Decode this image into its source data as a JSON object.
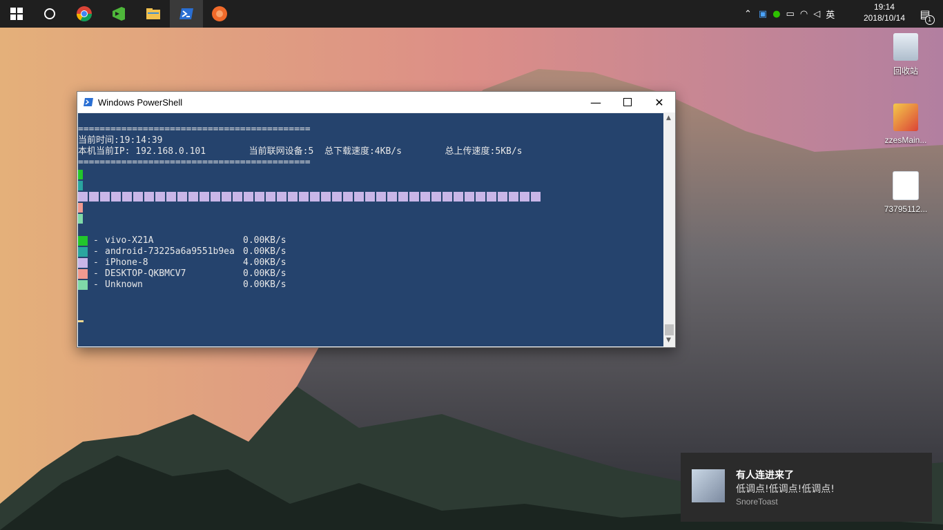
{
  "taskbar": {
    "clock_time": "19:14",
    "clock_date": "2018/10/14",
    "ime_label": "英",
    "notification_count": "1"
  },
  "desktop_icons": [
    {
      "label": "回收站"
    },
    {
      "label": "zzesMain..."
    },
    {
      "label": "73795112..."
    }
  ],
  "powershell": {
    "title": "Windows PowerShell",
    "separator": "===========================================",
    "time_line": "当前时间:19:14:39",
    "info_line": "本机当前IP: 192.168.0.101        当前联网设备:5  总下载速度:4KB/s        总上传速度:5KB/s",
    "devices": [
      {
        "name": "vivo-X21A",
        "speed": "0.00KB/s",
        "color": "#22c62b"
      },
      {
        "name": "android-73225a6a9551b9ea",
        "speed": "0.00KB/s",
        "color": "#2aa59f"
      },
      {
        "name": "iPhone-8",
        "speed": "4.00KB/s",
        "color": "#c9b6e8"
      },
      {
        "name": "DESKTOP-QKBMCV7",
        "speed": "0.00KB/s",
        "color": "#f09a90"
      },
      {
        "name": "Unknown",
        "speed": "0.00KB/s",
        "color": "#7fd9a8"
      }
    ],
    "iphone_bar_fraction": 1.0
  },
  "toast": {
    "title": "有人连进来了",
    "message": "低调点!低调点!低调点!",
    "app": "SnoreToast"
  }
}
